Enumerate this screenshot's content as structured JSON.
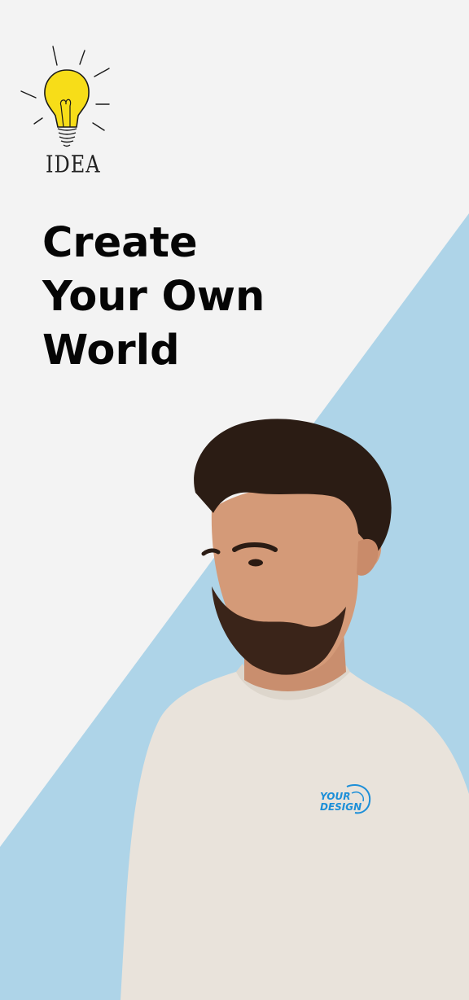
{
  "logo": {
    "icon": "lightbulb-icon",
    "label": "IDEA",
    "bulb_color": "#f7dd18"
  },
  "hero": {
    "line1": "Create",
    "line2": "Your Own",
    "line3": "World"
  },
  "model": {
    "shirt_color": "#e9e3db",
    "badge_line1": "YOUR",
    "badge_line2": "DESIGN"
  },
  "colors": {
    "background": "#f3f3f3",
    "accent": "#aed4e8",
    "headline": "#050505"
  }
}
